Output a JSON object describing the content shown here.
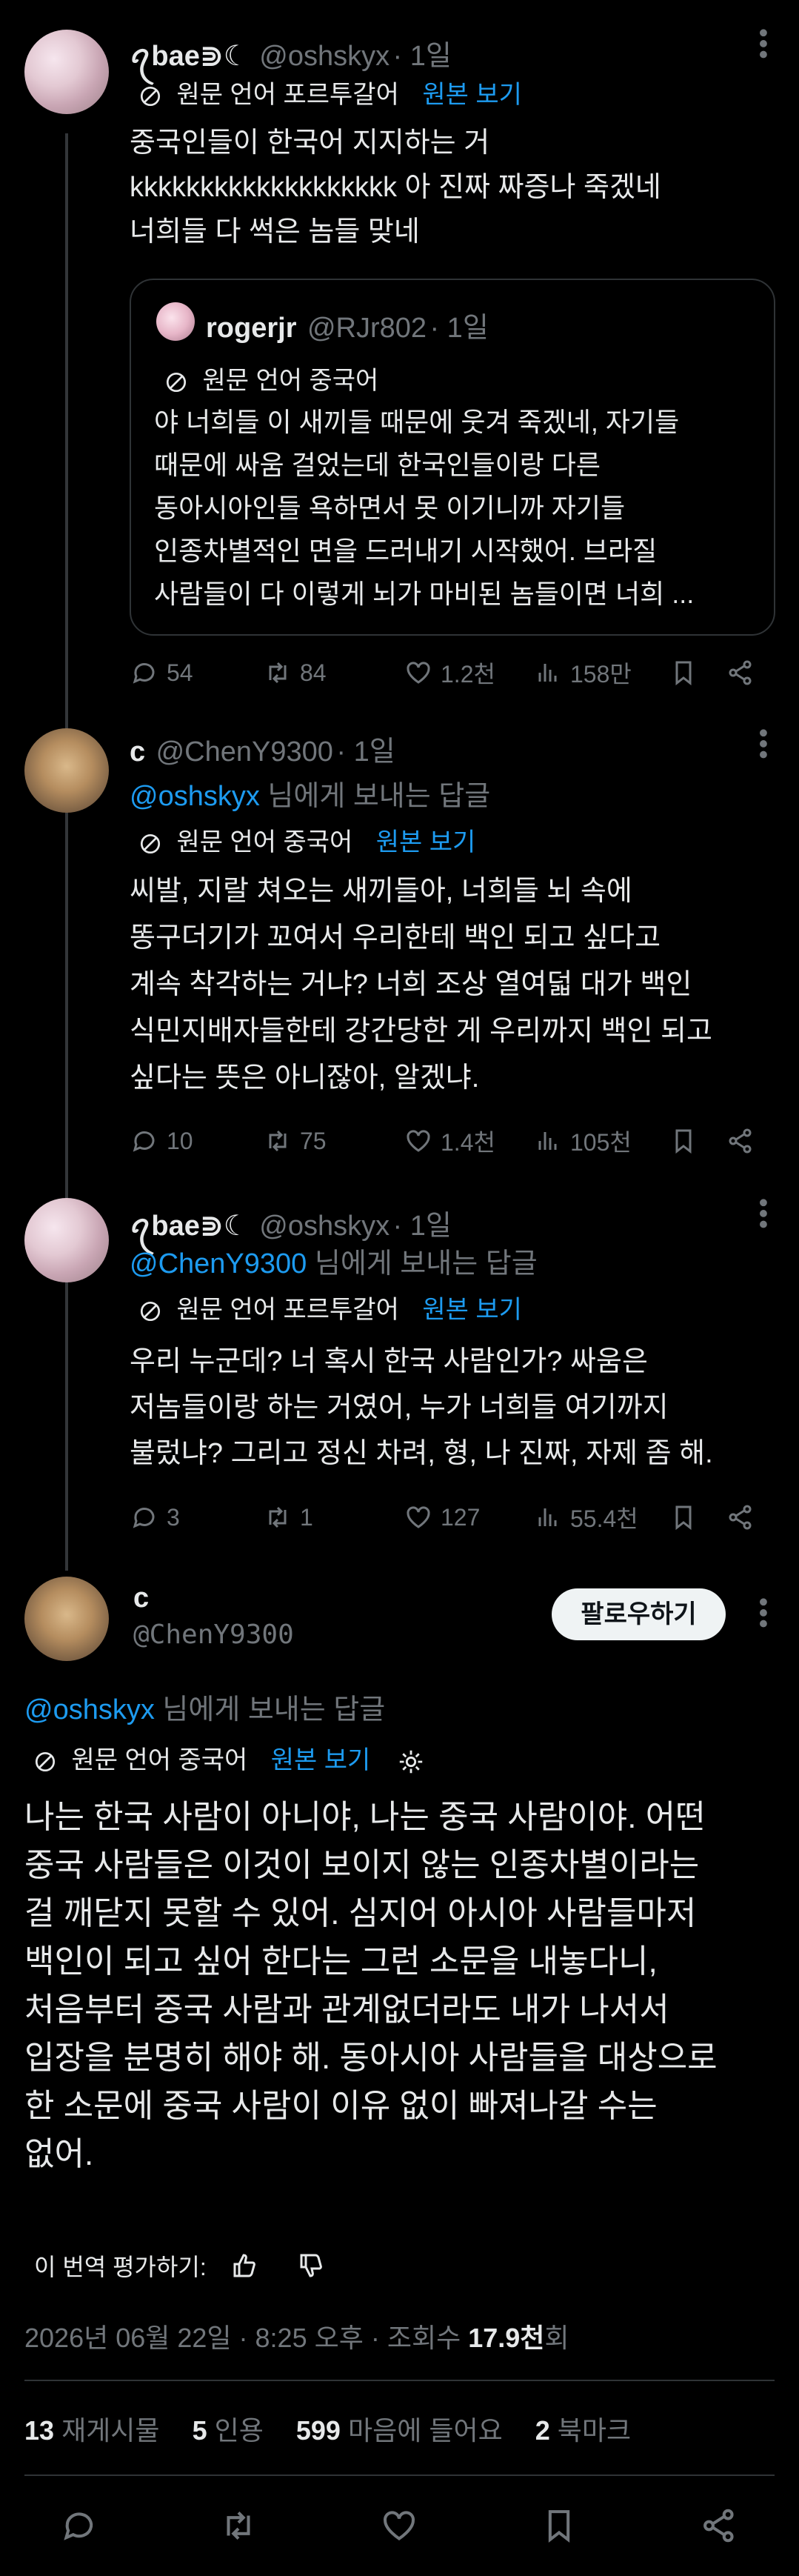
{
  "tweets": [
    {
      "display_name": "ꪖbae⋑☾",
      "handle": "@oshskyx",
      "time": "· 1일",
      "translation": {
        "label": "원문 언어 포르투갈어",
        "link": "원본 보기"
      },
      "text": "중국인들이 한국어 지지하는 거\nkkkkkkkkkkkkkkkkkkk 아 진짜 짜증나 죽겠네\n너희들 다 썩은 놈들 맞네",
      "quote": {
        "display_name": "rogerjr",
        "handle": "@RJr802",
        "time": "· 1일",
        "translation_label": "원문 언어 중국어",
        "text": "야 너희들 이 새끼들 때문에 웃겨 죽겠네, 자기들\n때문에 싸움 걸었는데 한국인들이랑 다른\n동아시아인들 욕하면서 못 이기니까 자기들\n인종차별적인 면을 드러내기 시작했어. 브라질\n사람들이 다 이렇게 뇌가 마비된 놈들이면 너희 ..."
      },
      "stats": {
        "replies": "54",
        "reposts": "84",
        "likes": "1.2천",
        "views": "158만"
      }
    },
    {
      "display_name": "c",
      "handle": "@ChenY9300",
      "time": "· 1일",
      "reply_to": {
        "mention": "@oshskyx",
        "suffix": " 님에게 보내는 답글"
      },
      "translation": {
        "label": "원문 언어 중국어",
        "link": "원본 보기"
      },
      "text": "씨발, 지랄 쳐오는 새끼들아, 너희들 뇌 속에\n똥구더기가 꼬여서 우리한테 백인 되고 싶다고\n계속 착각하는 거냐? 너희 조상 열여덟 대가 백인\n식민지배자들한테 강간당한 게 우리까지 백인 되고\n싶다는 뜻은 아니잖아, 알겠냐.",
      "stats": {
        "replies": "10",
        "reposts": "75",
        "likes": "1.4천",
        "views": "105천"
      }
    },
    {
      "display_name": "ꪖbae⋑☾",
      "handle": "@oshskyx",
      "time": "· 1일",
      "reply_to": {
        "mention": "@ChenY9300",
        "suffix": " 님에게 보내는 답글"
      },
      "translation": {
        "label": "원문 언어 포르투갈어",
        "link": "원본 보기"
      },
      "text": "우리 누군데? 너 혹시 한국 사람인가? 싸움은\n저놈들이랑 하는 거였어, 누가 너희들 여기까지\n불렀냐? 그리고 정신 차려, 형, 나 진짜, 자제 좀 해.",
      "stats": {
        "replies": "3",
        "reposts": "1",
        "likes": "127",
        "views": "55.4천"
      }
    }
  ],
  "main": {
    "display_name": "c",
    "handle": "@ChenY9300",
    "follow_label": "팔로우하기",
    "reply_to": {
      "mention": "@oshskyx",
      "suffix": " 님에게 보내는 답글"
    },
    "translation": {
      "label": "원문 언어 중국어",
      "link": "원본 보기"
    },
    "text": "나는 한국 사람이 아니야, 나는 중국 사람이야. 어떤\n중국 사람들은 이것이 보이지 않는 인종차별이라는\n걸 깨닫지 못할 수 있어. 심지어 아시아 사람들마저\n백인이 되고 싶어 한다는 그런 소문을 내놓다니,\n처음부터 중국 사람과 관계없더라도 내가 나서서\n입장을 분명히 해야 해. 동아시아 사람들을 대상으로\n한 소문에 중국 사람이 이유 없이 빠져나갈 수는\n없어.",
    "rate_label": "이 번역 평가하기:",
    "timestamp": "2026년 06월 22일 · 8:25 오후 · 조회수 ",
    "views_count": "17.9천",
    "views_suffix": "회",
    "counts": [
      {
        "num": "13",
        "label": "재게시물"
      },
      {
        "num": "5",
        "label": "인용"
      },
      {
        "num": "599",
        "label": "마음에 들어요"
      },
      {
        "num": "2",
        "label": "북마크"
      }
    ]
  },
  "colors": {
    "accent": "#1d9bf0",
    "muted": "#71767b",
    "text": "#e7e9ea",
    "bg": "#000000",
    "border": "#2f3336"
  }
}
